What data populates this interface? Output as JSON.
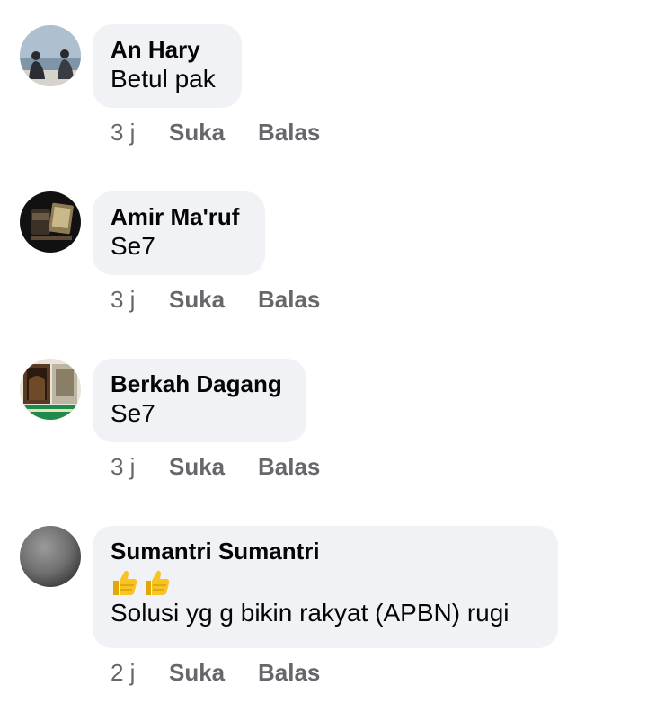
{
  "comments": [
    {
      "author": "An Hary",
      "text": "Betul pak",
      "time": "3 j",
      "like_label": "Suka",
      "reply_label": "Balas",
      "avatar_icon": "avatar-photo-couple-seaside"
    },
    {
      "author": "Amir Ma'ruf",
      "text": "Se7",
      "time": "3 j",
      "like_label": "Suka",
      "reply_label": "Balas",
      "avatar_icon": "avatar-photo-products"
    },
    {
      "author": "Berkah Dagang",
      "text": "Se7",
      "time": "3 j",
      "like_label": "Suka",
      "reply_label": "Balas",
      "avatar_icon": "avatar-photo-shop-interior"
    },
    {
      "author": "Sumantri Sumantri",
      "emoji": "👍👍",
      "text": "Solusi yg g bikin rakyat (APBN) rugi",
      "time": "2 j",
      "like_label": "Suka",
      "reply_label": "Balas",
      "avatar_icon": "avatar-photo-gray"
    }
  ],
  "colors": {
    "bubble": "#f0f2f5",
    "meta_text": "#65676b",
    "emoji_thumb": "#f7c325"
  }
}
